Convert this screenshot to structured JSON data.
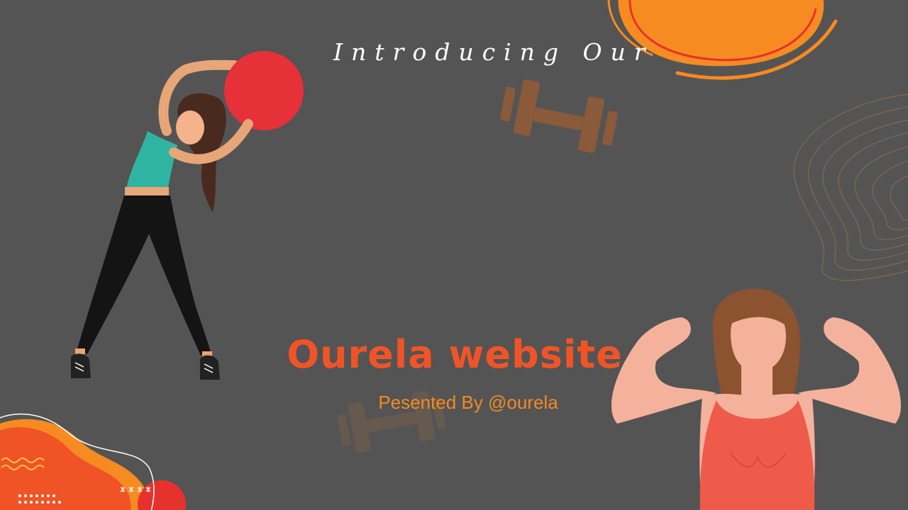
{
  "slide": {
    "intro_text": "Introducing Our",
    "title": "Ourela website",
    "presenter": "Pesented By @ourela"
  },
  "colors": {
    "background": "#545454",
    "title": "#f05426",
    "presenter": "#f08a24",
    "intro": "#ffffff",
    "sun_orange": "#f68b22",
    "ball_red": "#e63138",
    "dumbbell_brown": "#8a5a3b"
  },
  "illustrations": {
    "figure_left": "woman-stretching-with-ball",
    "figure_right": "woman-flexing-arms",
    "decor": [
      "sun-blob",
      "dumbbell-icon",
      "faded-dumbbell-icon",
      "topographic-lines",
      "corner-blob"
    ]
  }
}
